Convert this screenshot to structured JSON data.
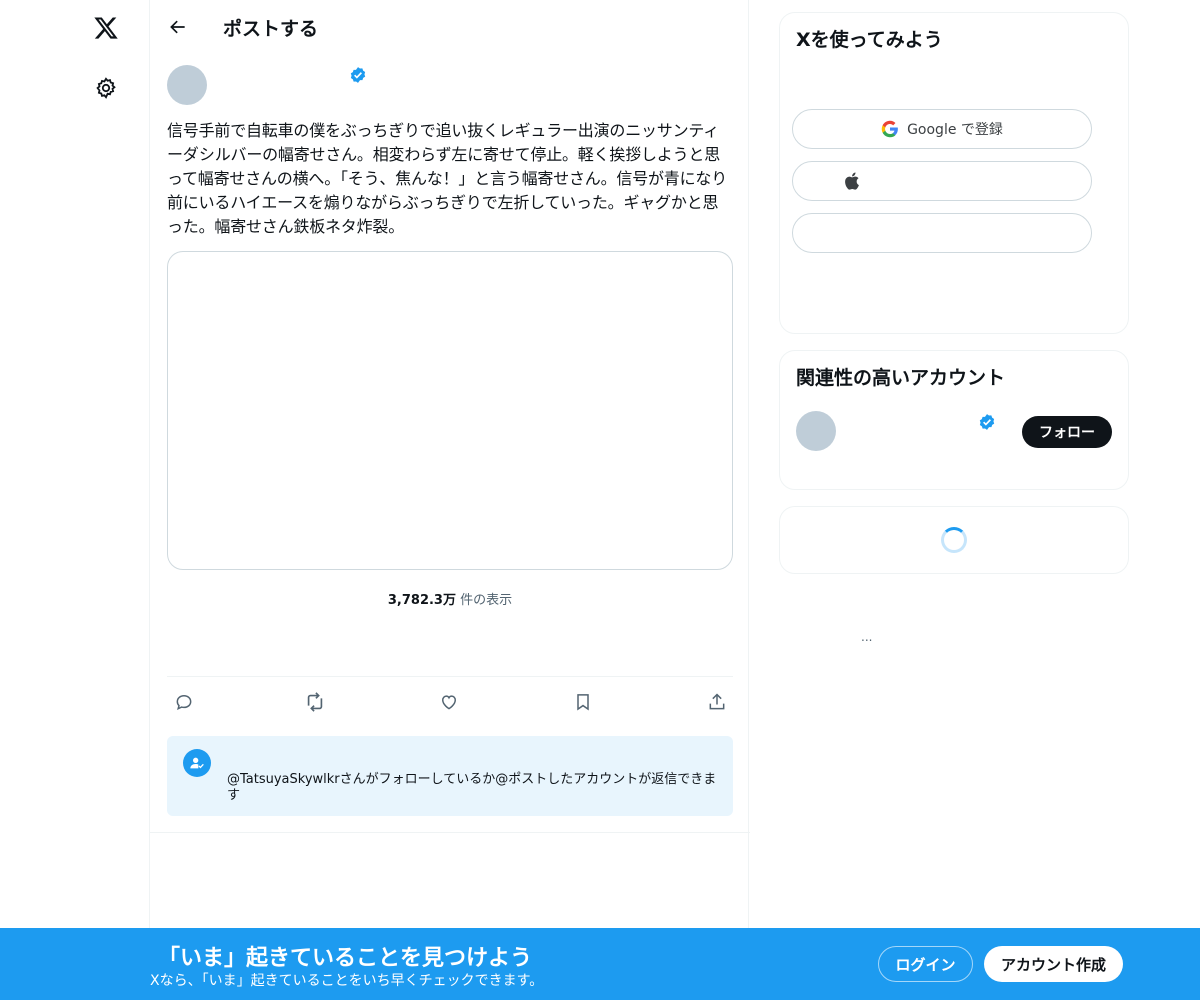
{
  "nav": {
    "logo_icon": "x-logo-icon",
    "settings_icon": "gear-icon"
  },
  "header": {
    "back_icon": "arrow-left-icon",
    "title": "ポストする"
  },
  "post": {
    "verified_icon": "verified-badge-icon",
    "text": "信号手前で自転車の僕をぶっちぎりで追い抜くレギュラー出演のニッサンティーダシルバーの幅寄せさん。相変わらず左に寄せて停止。軽く挨拶しようと思って幅寄せさんの横へ。「そう、焦んな！」と言う幅寄せさん。信号が青になり前にいるハイエースを煽りながらぶっちぎりで左折していった。ギャグかと思った。幅寄せさん鉄板ネタ炸裂。",
    "views_count": "3,782.3万",
    "views_label": " 件の表示",
    "actions": [
      "reply-icon",
      "repost-icon",
      "like-icon",
      "bookmark-icon",
      "share-icon"
    ],
    "reply_notice": "@TatsuyaSkywlkrさんがフォローしているか@ポストしたアカウントが返信できます"
  },
  "sidebar": {
    "signup_title": "Xを使ってみよう",
    "google_label": "Google で登録",
    "related_title": "関連性の高いアカウント",
    "follow_label": "フォロー",
    "more": "..."
  },
  "banner": {
    "title": "「いま」起きていることを見つけよう",
    "subtitle": "Xなら、「いま」起きていることをいち早くチェックできます。",
    "login_label": "ログイン",
    "signup_label": "アカウント作成"
  },
  "colors": {
    "accent": "#1d9bf0",
    "text": "#0f1419",
    "muted": "#536471",
    "avatar_placeholder": "#bfcdd8"
  }
}
